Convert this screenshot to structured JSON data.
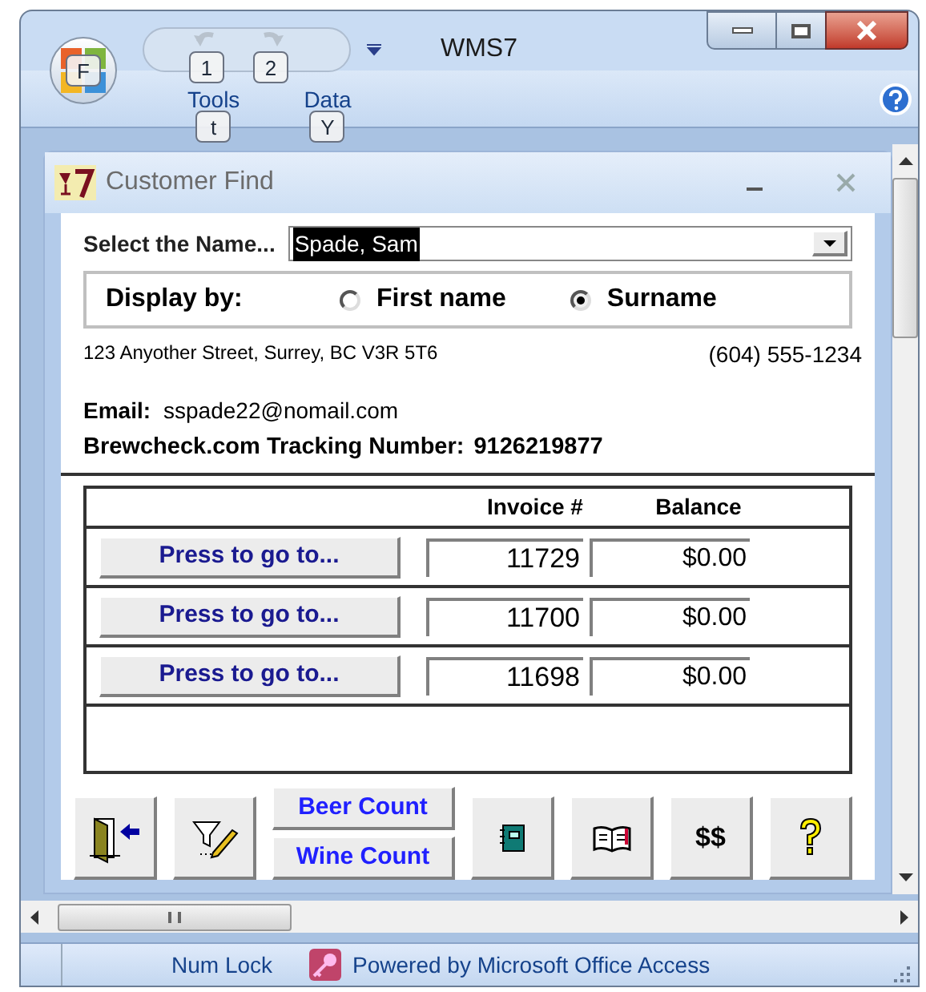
{
  "window": {
    "title": "WMS7"
  },
  "office_button": {
    "key_tip": "F"
  },
  "quick_access": [
    {
      "kind": "undo",
      "key_tip": "1"
    },
    {
      "kind": "redo",
      "key_tip": "2"
    }
  ],
  "ribbon_tabs": [
    {
      "label": "Tools",
      "key_tip": "t"
    },
    {
      "label": "Data",
      "key_tip": "Y"
    }
  ],
  "form": {
    "title": "Customer Find",
    "name_label": "Select the Name...",
    "name_value": "Spade, Sam",
    "display_by": {
      "label": "Display by:",
      "options": [
        {
          "label": "First name",
          "selected": false
        },
        {
          "label": "Surname",
          "selected": true
        }
      ]
    },
    "address": "123 Anyother Street, Surrey, BC V3R 5T6",
    "phone": "(604) 555-1234",
    "email_label": "Email:",
    "email": "sspade22@nomail.com",
    "tracking_label": "Brewcheck.com Tracking Number:",
    "tracking": "9126219877",
    "columns": [
      "Invoice #",
      "Balance"
    ],
    "rows": [
      {
        "button": "Press to go to...",
        "invoice": "11729",
        "balance": "$0.00"
      },
      {
        "button": "Press to go to...",
        "invoice": "11700",
        "balance": "$0.00"
      },
      {
        "button": "Press to go to...",
        "invoice": "11698",
        "balance": "$0.00"
      }
    ],
    "toolbar": [
      {
        "kind": "exit"
      },
      {
        "kind": "filter"
      },
      {
        "kind": "counts",
        "labels": [
          "Beer Count",
          "Wine Count"
        ]
      },
      {
        "kind": "notebook"
      },
      {
        "kind": "book"
      },
      {
        "kind": "text",
        "label": "$$"
      },
      {
        "kind": "help"
      }
    ]
  },
  "status_bar": {
    "num_lock": "Num Lock",
    "powered_by": "Powered by Microsoft Office Access"
  }
}
